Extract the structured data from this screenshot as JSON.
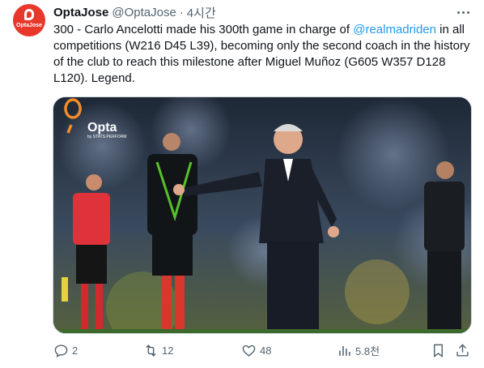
{
  "author": {
    "display_name": "OptaJose",
    "handle": "@OptaJose",
    "separator": "·",
    "time": "4시간",
    "avatar_text": "OptaJose"
  },
  "tweet": {
    "text_before": "300 - Carlo Ancelotti made his 300th game in charge of ",
    "mention": "@realmadriden",
    "text_after": " in all competitions (W216 D45 L39), becoming only the second coach in the history of the club to reach this milestone after Miguel Muñoz (G605 W357 D128 L120). Legend."
  },
  "media": {
    "watermark_brand": "Opta",
    "watermark_sub": "by STATS PERFORM"
  },
  "actions": {
    "replies": "2",
    "reposts": "12",
    "likes": "48",
    "views": "5.8천"
  },
  "colors": {
    "accent": "#1d9bf0",
    "avatar_bg": "#e8382b",
    "muted": "#536471"
  }
}
